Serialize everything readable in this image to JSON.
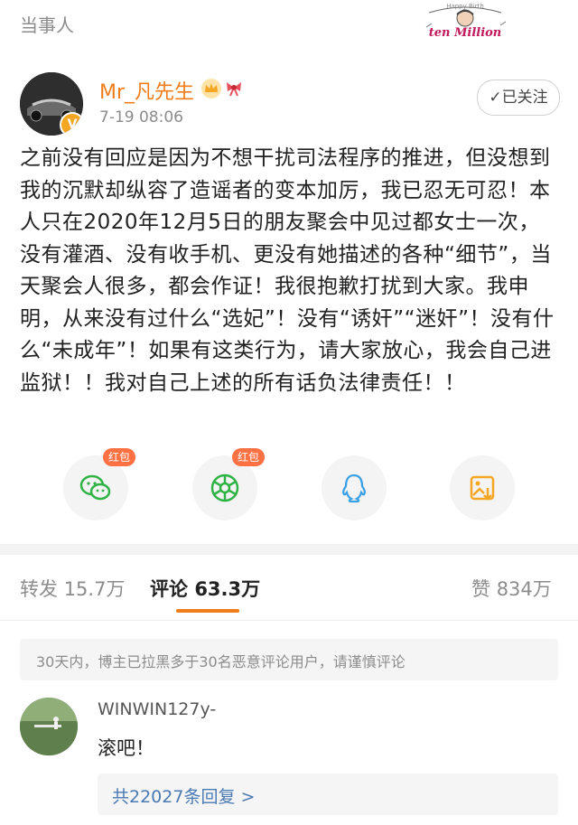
{
  "topbar": {
    "title": "当事人",
    "sticker_text_top": "Happy Birth",
    "sticker_text_main": "ten Million"
  },
  "post": {
    "username": "Mr_凡先生",
    "time": "7-19 08:06",
    "follow_label": "已关注",
    "body": "之前没有回应是因为不想干扰司法程序的推进，但没想到我的沉默却纵容了造谣者的变本加厉，我已忍无可忍！本人只在2020年12月5日的朋友聚会中见过都女士一次，没有灌酒、没有收手机、更没有她描述的各种“细节”，当天聚会人很多，都会作证！我很抱歉打扰到大家。我申明，从来没有过什么“选妃”！没有“诱奸”“迷奸”！没有什么“未成年”！如果有这类行为，请大家放心，我会自己进监狱！！我对自己上述的所有话负法律责任！！",
    "badge_icon": "v-verified-icon"
  },
  "share": {
    "redpack_label": "红包",
    "buttons": [
      "wechat-icon",
      "moments-icon",
      "qq-icon",
      "save-image-icon"
    ]
  },
  "tabs": {
    "repost_label": "转发",
    "repost_count": "15.7万",
    "comment_label": "评论",
    "comment_count": "63.3万",
    "like_label": "赞",
    "like_count": "834万"
  },
  "notice": "30天内，博主已拉黑多于30名恶意评论用户，请谨慎评论",
  "comment": {
    "name": "WINWIN127y-",
    "text": "滚吧！",
    "replies": "共22027条回复 >"
  },
  "colors": {
    "accent": "#f07c1a",
    "link": "#4a7ab3",
    "share_green": "#2fb344",
    "share_blue": "#3aa0e6",
    "save_orange": "#f5a623"
  }
}
